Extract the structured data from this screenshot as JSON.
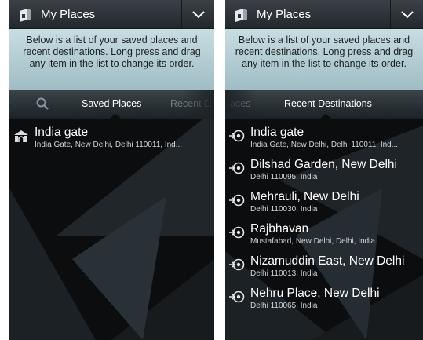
{
  "left_screen": {
    "header": {
      "title": "My Places",
      "app_icon": "map-icon",
      "menu_icon": "chevron-down-icon"
    },
    "info_text": "Below is a list of your saved places and recent destinations. Long press and drag any item in the list to change its order.",
    "tabs": {
      "search_icon": "search-icon",
      "active_label": "Saved Places",
      "next_label": "Recent D"
    },
    "items": [
      {
        "name": "India gate",
        "address": "India Gate, New Delhi, Delhi 110011, Ind...",
        "icon": "landmark-icon"
      }
    ]
  },
  "right_screen": {
    "header": {
      "title": "My Places",
      "app_icon": "map-icon",
      "menu_icon": "chevron-down-icon"
    },
    "info_text": "Below is a list of your saved places and recent destinations. Long press and drag any item in the list to change its order.",
    "tabs": {
      "prev_label": "aces",
      "active_label": "Recent Destinations"
    },
    "items": [
      {
        "name": "India gate",
        "address": "India Gate, New Delhi, Delhi 110011, Ind...",
        "icon": "recent-destination-icon"
      },
      {
        "name": "Dilshad Garden, New Delhi",
        "address": "Delhi 110095, India",
        "icon": "recent-destination-icon"
      },
      {
        "name": "Mehrauli, New Delhi",
        "address": "Delhi 110030, India",
        "icon": "recent-destination-icon"
      },
      {
        "name": "Rajbhavan",
        "address": "Mustafabad, New Delhi, Delhi, India",
        "icon": "recent-destination-icon"
      },
      {
        "name": "Nizamuddin East, New Delhi",
        "address": "Delhi 110013, India",
        "icon": "recent-destination-icon"
      },
      {
        "name": "Nehru Place, New Delhi",
        "address": "Delhi 110065, India",
        "icon": "recent-destination-icon"
      }
    ]
  },
  "colors": {
    "info_bg": "#b7d0d6",
    "list_bg": "#0b0d0f",
    "header_bg": "#2e3439"
  }
}
